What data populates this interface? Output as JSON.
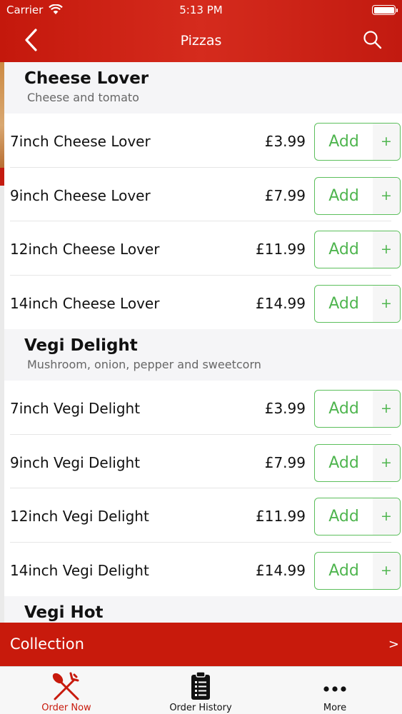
{
  "status_bar": {
    "carrier": "Carrier",
    "time": "5:13 PM"
  },
  "nav": {
    "title": "Pizzas"
  },
  "sections": [
    {
      "name": "Cheese Lover",
      "description": "Cheese and tomato",
      "items": [
        {
          "name": "7inch Cheese Lover",
          "price": "£3.99"
        },
        {
          "name": "9inch Cheese Lover",
          "price": "£7.99"
        },
        {
          "name": "12inch Cheese Lover",
          "price": "£11.99"
        },
        {
          "name": "14inch Cheese Lover",
          "price": "£14.99"
        }
      ]
    },
    {
      "name": "Vegi Delight",
      "description": "Mushroom, onion, pepper and sweetcorn",
      "items": [
        {
          "name": "7inch Vegi Delight",
          "price": "£3.99"
        },
        {
          "name": "9inch Vegi Delight",
          "price": "£7.99"
        },
        {
          "name": "12inch Vegi Delight",
          "price": "£11.99"
        },
        {
          "name": "14inch Vegi Delight",
          "price": "£14.99"
        }
      ]
    },
    {
      "name": "Vegi Hot"
    }
  ],
  "buttons": {
    "add_label": "Add",
    "plus": "+"
  },
  "collection": {
    "label": "Collection",
    "chevron": ">"
  },
  "tabs": [
    {
      "label": "Order Now",
      "icon": "fork-spoon-icon",
      "active": true
    },
    {
      "label": "Order History",
      "icon": "clipboard-list-icon",
      "active": false
    },
    {
      "label": "More",
      "icon": "ellipsis-icon",
      "active": false
    }
  ],
  "colors": {
    "brand_red": "#c81a0c",
    "add_green": "#4fb54f",
    "active_tab": "#c81a0c"
  }
}
